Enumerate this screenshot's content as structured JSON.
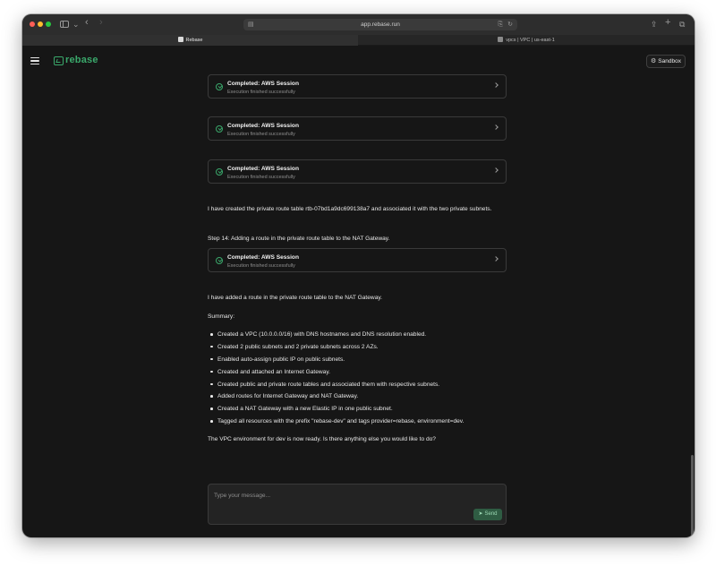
{
  "browser": {
    "url": "app.rebase.run",
    "tabs": [
      {
        "label": "Rebase"
      },
      {
        "label": "vpcs | VPC | us-east-1"
      }
    ]
  },
  "header": {
    "logo_text": "rebase",
    "sandbox_label": "Sandbox"
  },
  "chat": {
    "sessions": [
      {
        "title": "Completed: AWS Session",
        "subtitle": "Execution finished successfully"
      },
      {
        "title": "Completed: AWS Session",
        "subtitle": "Execution finished successfully"
      },
      {
        "title": "Completed: AWS Session",
        "subtitle": "Execution finished successfully"
      },
      {
        "title": "Completed: AWS Session",
        "subtitle": "Execution finished successfully"
      }
    ],
    "route_table_msg": "I have created the private route table rtb-07bd1a9dc699138a7 and associated it with the two private subnets.",
    "step14_msg": "Step 14: Adding a route in the private route table to the NAT Gateway.",
    "nat_route_msg": "I have added a route in the private route table to the NAT Gateway.",
    "summary_label": "Summary:",
    "summary_items": [
      "Created a VPC (10.0.0.0/16) with DNS hostnames and DNS resolution enabled.",
      "Created 2 public subnets and 2 private subnets across 2 AZs.",
      "Enabled auto-assign public IP on public subnets.",
      "Created and attached an Internet Gateway.",
      "Created public and private route tables and associated them with respective subnets.",
      "Added routes for Internet Gateway and NAT Gateway.",
      "Created a NAT Gateway with a new Elastic IP in one public subnet.",
      "Tagged all resources with the prefix \"rebase-dev\" and tags provider=rebase, environment=dev."
    ],
    "closing_msg": "The VPC environment for dev is now ready. Is there anything else you would like to do?"
  },
  "composer": {
    "placeholder": "Type your message...",
    "value": "",
    "send_label": "Send"
  },
  "colors": {
    "accent": "#3aa86b",
    "background": "#161616",
    "card_border": "#3a3a3a",
    "send_bg": "#2f5c43"
  }
}
